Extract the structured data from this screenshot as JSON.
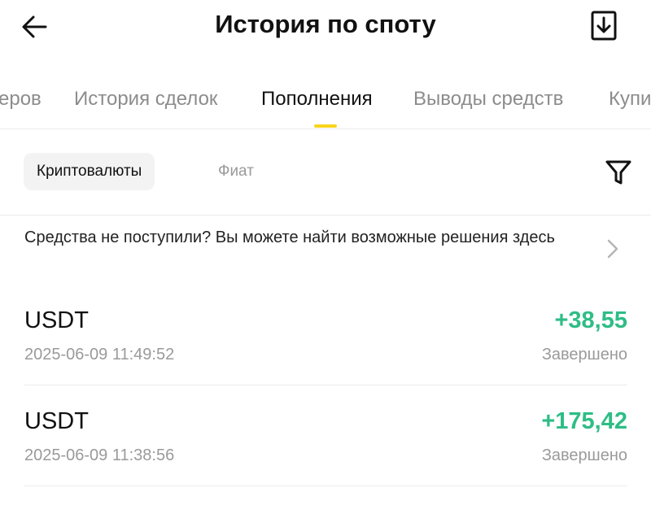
{
  "header": {
    "title": "История по споту",
    "back_icon": "arrow-left-icon",
    "download_icon": "download-icon"
  },
  "tabs": [
    {
      "label": "еров",
      "active": false
    },
    {
      "label": "История сделок",
      "active": false
    },
    {
      "label": "Пополнения",
      "active": true
    },
    {
      "label": "Выводы средств",
      "active": false
    },
    {
      "label": "Купи",
      "active": false
    }
  ],
  "filters": {
    "chips": [
      {
        "label": "Криптовалюты",
        "active": true
      },
      {
        "label": "Фиат",
        "active": false
      }
    ],
    "filter_icon": "funnel-icon"
  },
  "notice": {
    "text": "Средства не поступили? Вы можете найти возможные решения здесь",
    "chevron_icon": "chevron-right-icon"
  },
  "records": [
    {
      "coin": "USDT",
      "amount": "+38,55",
      "time": "2025-06-09 11:49:52",
      "status": "Завершено"
    },
    {
      "coin": "USDT",
      "amount": "+175,42",
      "time": "2025-06-09 11:38:56",
      "status": "Завершено"
    }
  ],
  "colors": {
    "accent": "#f7d51d",
    "positive": "#2ebd85",
    "muted": "#9a9a9a"
  }
}
